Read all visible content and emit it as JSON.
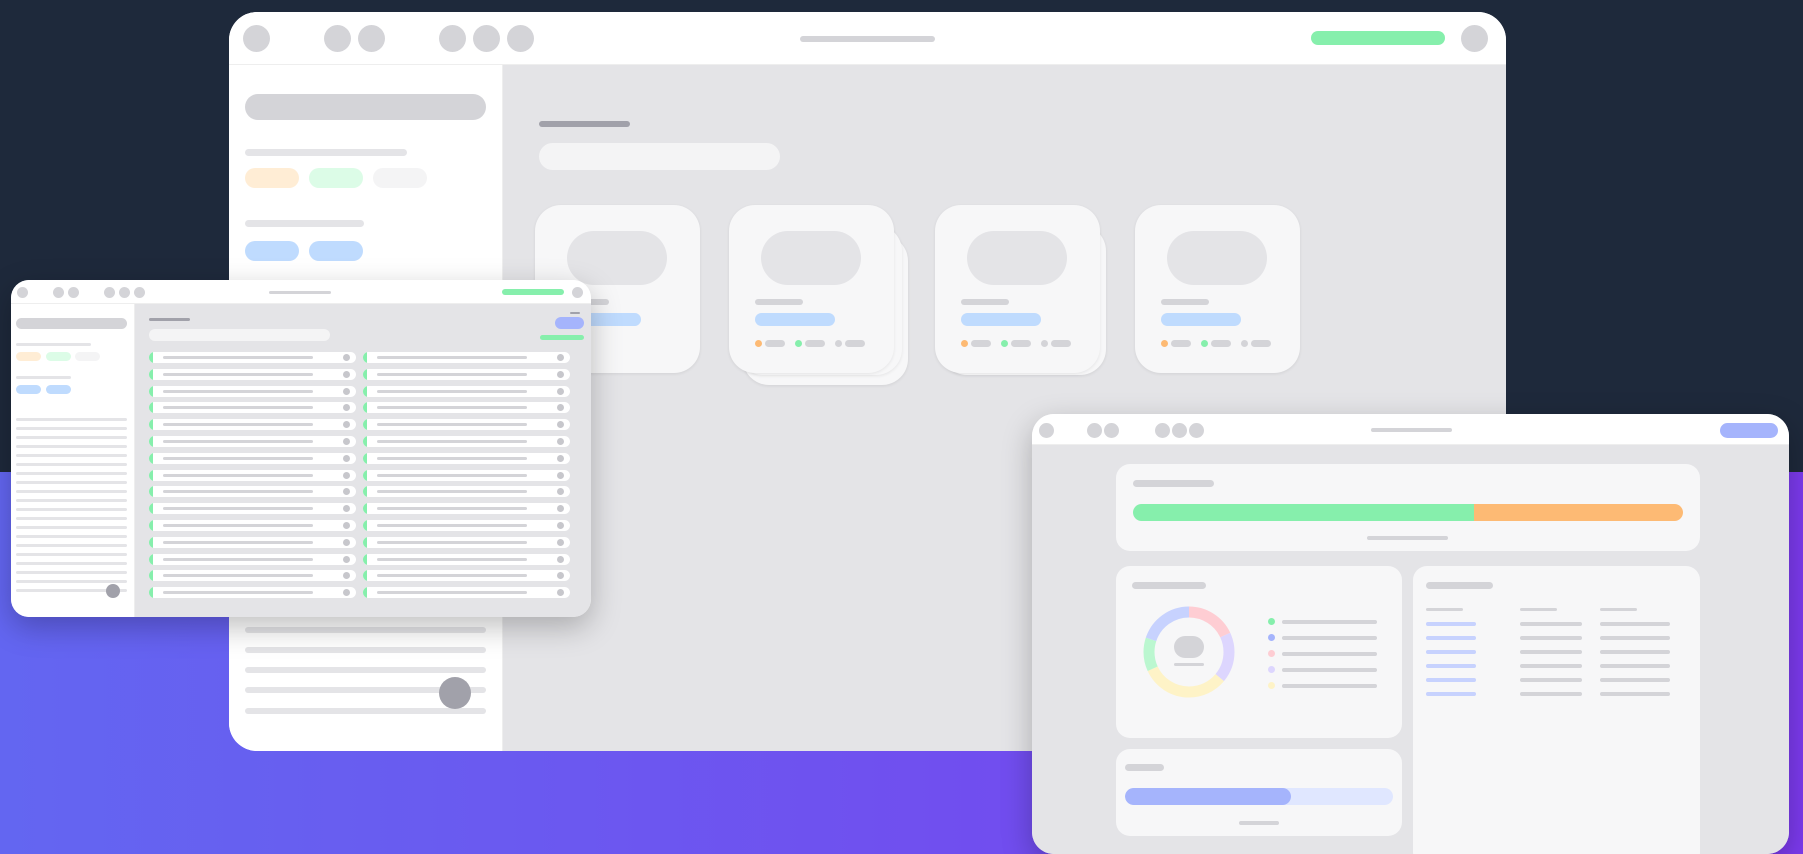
{
  "colors": {
    "bg_top": "#1e293b",
    "bg_bottom_start": "#6366f1",
    "bg_bottom_end": "#7c3aed",
    "accent_green": "#86efac",
    "accent_orange": "#fdba74",
    "accent_blue_light": "#bfdbfe",
    "accent_indigo": "#a5b4fc",
    "placeholder_gray": "#d4d4d8",
    "window_body": "#e4e4e7",
    "card_bg": "#f7f7f8"
  },
  "main_window": {
    "toolbar_icons": [
      "circle-icon",
      "circle-icon",
      "circle-icon",
      "circle-icon",
      "circle-icon",
      "circle-icon"
    ],
    "card_count": 4
  },
  "list_window": {
    "row_count": 15,
    "columns": 2
  },
  "dashboard_window": {
    "progress": {
      "segments": [
        {
          "color": "#86efac",
          "fraction": 0.62
        },
        {
          "color": "#fdba74",
          "fraction": 0.38
        }
      ]
    },
    "donut": {
      "segments": [
        {
          "color": "#fecdd3",
          "fraction": 0.18
        },
        {
          "color": "#ddd6fe",
          "fraction": 0.18
        },
        {
          "color": "#fef3c7",
          "fraction": 0.32
        },
        {
          "color": "#bbf7d0",
          "fraction": 0.12
        },
        {
          "color": "#c7d2fe",
          "fraction": 0.2
        }
      ]
    },
    "legend_colors": [
      "#86efac",
      "#a5b4fc",
      "#fecdd3",
      "#ddd6fe",
      "#fef3c7"
    ],
    "bottom_progress_fraction": 0.62
  }
}
